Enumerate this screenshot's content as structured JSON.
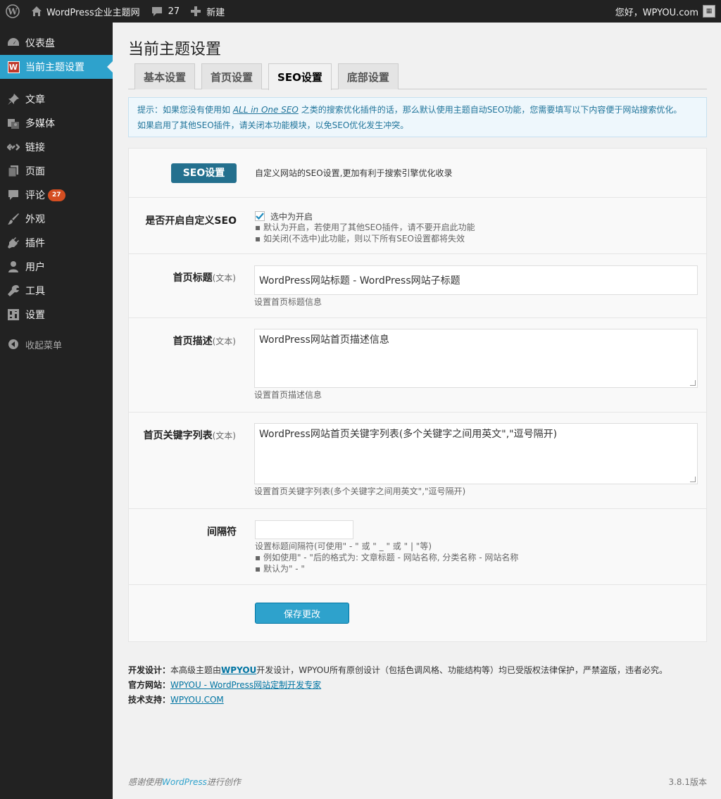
{
  "adminbar": {
    "site_name": "WordPress企业主题网",
    "comments_count": "27",
    "new_label": "新建",
    "greeting": "您好，WPYOU.com"
  },
  "sidebar": {
    "items": [
      {
        "label": "仪表盘",
        "icon": "dashboard-icon"
      },
      {
        "label": "当前主题设置",
        "icon": "w-logo-icon"
      },
      {
        "label": "文章",
        "icon": "pin-icon"
      },
      {
        "label": "多媒体",
        "icon": "media-icon"
      },
      {
        "label": "链接",
        "icon": "link-icon"
      },
      {
        "label": "页面",
        "icon": "page-icon"
      },
      {
        "label": "评论",
        "icon": "comment-icon",
        "count": "27"
      },
      {
        "label": "外观",
        "icon": "brush-icon"
      },
      {
        "label": "插件",
        "icon": "plug-icon"
      },
      {
        "label": "用户",
        "icon": "user-icon"
      },
      {
        "label": "工具",
        "icon": "wrench-icon"
      },
      {
        "label": "设置",
        "icon": "settings-icon"
      }
    ],
    "collapse_label": "收起菜单",
    "accent": "#2ea2cc"
  },
  "page": {
    "title": "当前主题设置",
    "tabs": [
      "基本设置",
      "首页设置",
      "SEO设置",
      "底部设置"
    ],
    "active_tab": "SEO设置"
  },
  "notice": {
    "prefix": "提示：如果您没有使用如 ",
    "link": "ALL in One SEO",
    "suffix": " 之类的搜索优化插件的话，那么默认使用主题自动SEO功能，您需要填写以下内容便于网站搜索优化。",
    "line2": "如果启用了其他SEO插件，请关闭本功能模块，以免SEO优化发生冲突。"
  },
  "form": {
    "section_badge": "SEO设置",
    "section_desc": "自定义网站的SEO设置,更加有利于搜索引擎优化收录",
    "enable": {
      "label": "是否开启自定义SEO",
      "checkbox_label": "选中为开启",
      "hint1": "▪ 默认为开启，若使用了其他SEO插件，请不要开启此功能",
      "hint2": "▪ 如关闭(不选中)此功能，则以下所有SEO设置都将失效",
      "checked": true
    },
    "home_title": {
      "label": "首页标题",
      "type": "(文本)",
      "value": "WordPress网站标题 - WordPress网站子标题",
      "desc": "设置首页标题信息"
    },
    "home_desc": {
      "label": "首页描述",
      "type": "(文本)",
      "value": "WordPress网站首页描述信息",
      "desc": "设置首页描述信息"
    },
    "home_keywords": {
      "label": "首页关键字列表",
      "type": "(文本)",
      "value": "WordPress网站首页关键字列表(多个关键字之间用英文\",\"逗号隔开)",
      "desc": "设置首页关键字列表(多个关键字之间用英文\",\"逗号隔开)"
    },
    "separator": {
      "label": "间隔符",
      "value": "",
      "desc1": "设置标题间隔符(可使用\" - \" 或 \" _ \" 或 \" | \"等)",
      "desc2": "▪ 例如使用\" - \"后的格式为: 文章标题 - 网站名称, 分类名称 - 网站名称",
      "desc3": "▪ 默认为\" - \""
    },
    "save_label": "保存更改"
  },
  "credits": {
    "dev_label": "开发设计：",
    "dev_text_pre": "本高级主题由",
    "dev_brand": "WPYOU",
    "dev_text_post": "开发设计，WPYOU所有原创设计（包括色调风格、功能结构等）均已受版权法律保护，严禁盗版，违者必究。",
    "site_label": "官方网站：",
    "site_link": "WPYOU - WordPress网站定制开发专家",
    "support_label": "技术支持：",
    "support_link": "WPYOU.COM"
  },
  "footer": {
    "thanks_pre": "感谢使用",
    "thanks_link": "WordPress",
    "thanks_post": "进行创作",
    "version": "3.8.1版本"
  }
}
